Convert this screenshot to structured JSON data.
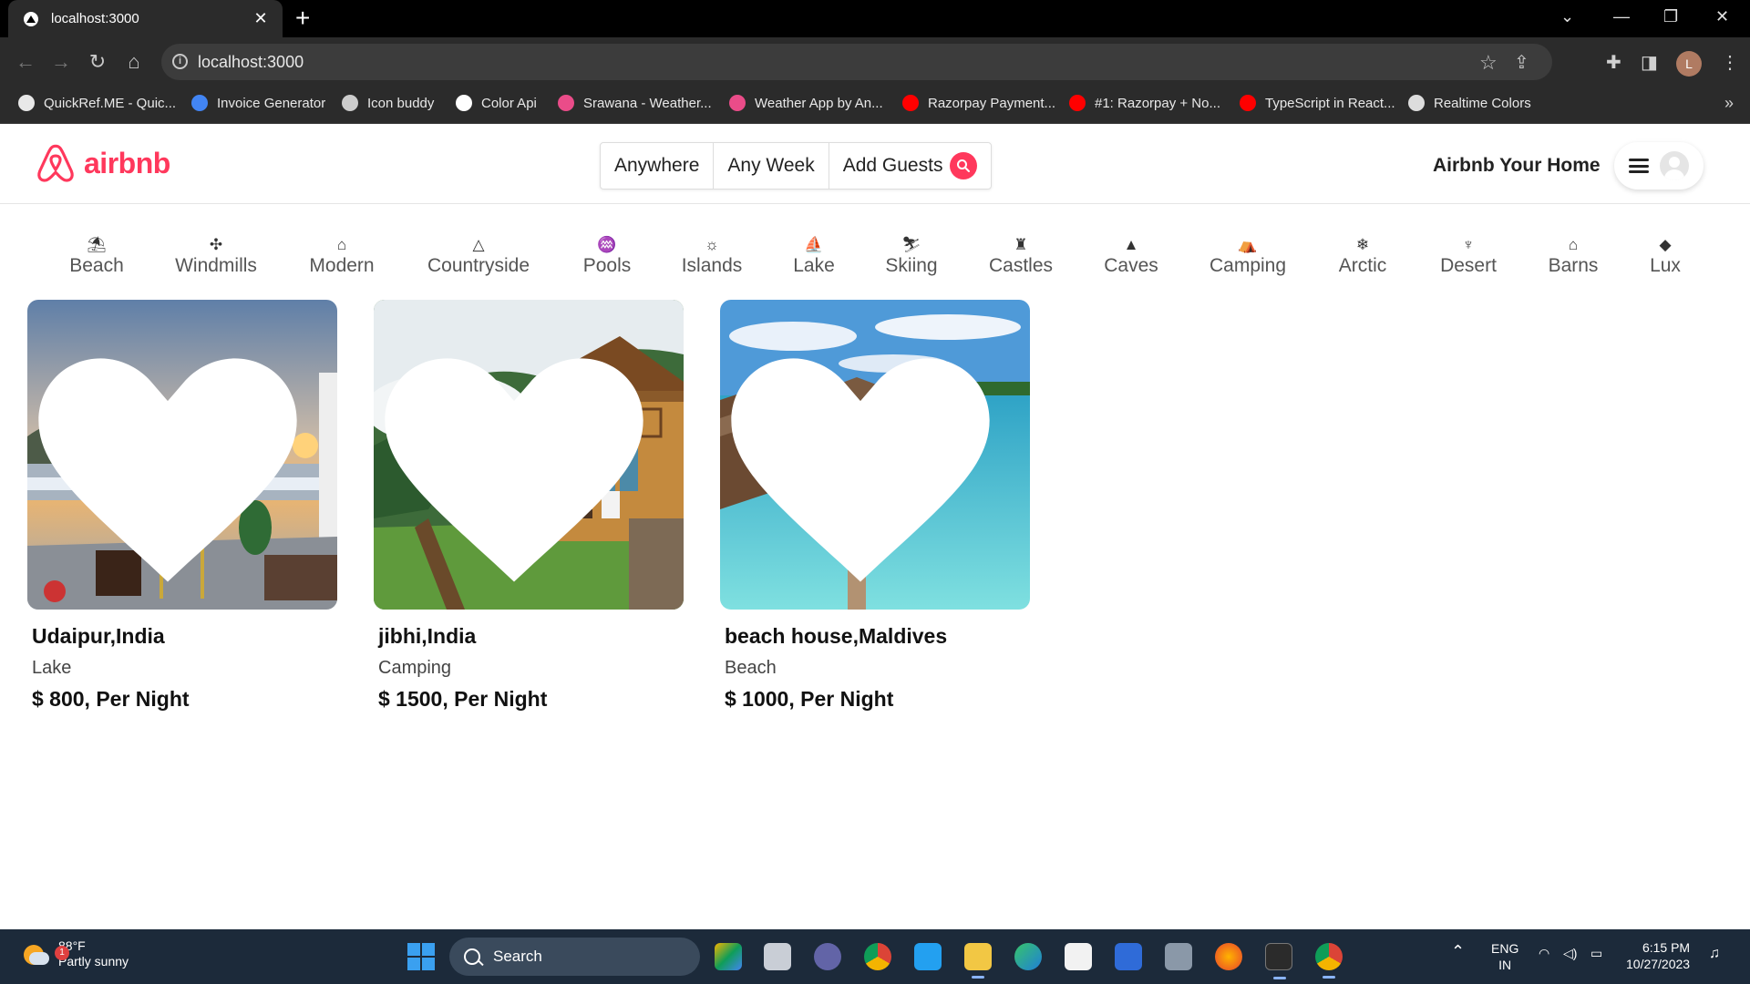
{
  "browser": {
    "tab_title": "localhost:3000",
    "new_tab": "+",
    "url": "localhost:3000",
    "profile_initial": "L",
    "bookmarks": [
      {
        "label": "QuickRef.ME - Quic...",
        "color": "#e8e8e8"
      },
      {
        "label": "Invoice Generator",
        "color": "#4285f4"
      },
      {
        "label": "Icon buddy",
        "color": "#cccccc"
      },
      {
        "label": "Color Api",
        "color": "#ffffff"
      },
      {
        "label": "Srawana - Weather...",
        "color": "#ea4c89"
      },
      {
        "label": "Weather App by An...",
        "color": "#ea4c89"
      },
      {
        "label": "Razorpay Payment...",
        "color": "#ff0000"
      },
      {
        "label": "#1: Razorpay + No...",
        "color": "#ff0000"
      },
      {
        "label": "TypeScript in React...",
        "color": "#ff0000"
      },
      {
        "label": "Realtime Colors",
        "color": "#dddddd"
      }
    ],
    "bookmarks_more": "»"
  },
  "header": {
    "logo_text": "airbnb",
    "brand_color": "#ff385c",
    "search": {
      "anywhere": "Anywhere",
      "any_week": "Any Week",
      "add_guests": "Add Guests"
    },
    "host_link": "Airbnb Your Home"
  },
  "categories": [
    {
      "label": "Beach",
      "icon": "umbrella-beach-icon",
      "glyph": "⛱"
    },
    {
      "label": "Windmills",
      "icon": "windmill-icon",
      "glyph": "✣"
    },
    {
      "label": "Modern",
      "icon": "modern-house-icon",
      "glyph": "⌂"
    },
    {
      "label": "Countryside",
      "icon": "mountain-icon",
      "glyph": "△"
    },
    {
      "label": "Pools",
      "icon": "pool-icon",
      "glyph": "♒"
    },
    {
      "label": "Islands",
      "icon": "island-icon",
      "glyph": "☼"
    },
    {
      "label": "Lake",
      "icon": "boat-icon",
      "glyph": "⛵"
    },
    {
      "label": "Skiing",
      "icon": "skiing-icon",
      "glyph": "⛷"
    },
    {
      "label": "Castles",
      "icon": "castle-icon",
      "glyph": "♜"
    },
    {
      "label": "Caves",
      "icon": "cave-icon",
      "glyph": "▲"
    },
    {
      "label": "Camping",
      "icon": "tent-icon",
      "glyph": "⛺"
    },
    {
      "label": "Arctic",
      "icon": "snowflake-icon",
      "glyph": "❄"
    },
    {
      "label": "Desert",
      "icon": "cactus-icon",
      "glyph": "♆"
    },
    {
      "label": "Barns",
      "icon": "barn-icon",
      "glyph": "⌂"
    },
    {
      "label": "Lux",
      "icon": "diamond-icon",
      "glyph": "◆"
    }
  ],
  "listings": [
    {
      "title": "Udaipur,India",
      "category": "Lake",
      "price": "$ 800, Per Night"
    },
    {
      "title": "jibhi,India",
      "category": "Camping",
      "price": "$ 1500, Per Night"
    },
    {
      "title": "beach house,Maldives",
      "category": "Beach",
      "price": "$ 1000, Per Night"
    }
  ],
  "taskbar": {
    "weather_badge": "1",
    "temperature": "88°F",
    "condition": "Partly sunny",
    "search_label": "Search",
    "lang": "ENG",
    "region": "IN",
    "time": "6:15 PM",
    "date": "10/27/2023"
  }
}
